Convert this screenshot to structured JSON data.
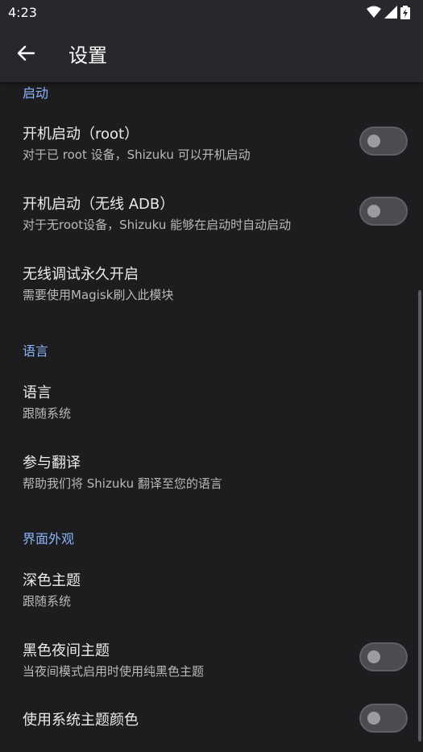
{
  "status_bar": {
    "time": "4:23"
  },
  "app_bar": {
    "title": "设置"
  },
  "sections": {
    "startup": {
      "header": "启动",
      "boot_root": {
        "title": "开机启动（root）",
        "summary": "对于已 root 设备，Shizuku 可以开机启动",
        "enabled": false
      },
      "boot_adb": {
        "title": "开机启动（无线 ADB）",
        "summary": "对于无root设备，Shizuku 能够在启动时自动启动",
        "enabled": false
      },
      "wireless_debug": {
        "title": "无线调试永久开启",
        "summary": "需要使用Magisk刷入此模块"
      }
    },
    "language": {
      "header": "语言",
      "language_item": {
        "title": "语言",
        "summary": "跟随系统"
      },
      "translate": {
        "title": "参与翻译",
        "summary": "帮助我们将 Shizuku 翻译至您的语言"
      }
    },
    "appearance": {
      "header": "界面外观",
      "dark_theme": {
        "title": "深色主题",
        "summary": "跟随系统"
      },
      "black_night": {
        "title": "黑色夜间主题",
        "summary": "当夜间模式启用时使用纯黑色主题",
        "enabled": false
      },
      "system_colors": {
        "title": "使用系统主题颜色",
        "enabled": false
      }
    }
  },
  "colors": {
    "accent": "#8ab4f8",
    "background": "#1d1d1f",
    "toolbar": "#27282c"
  }
}
